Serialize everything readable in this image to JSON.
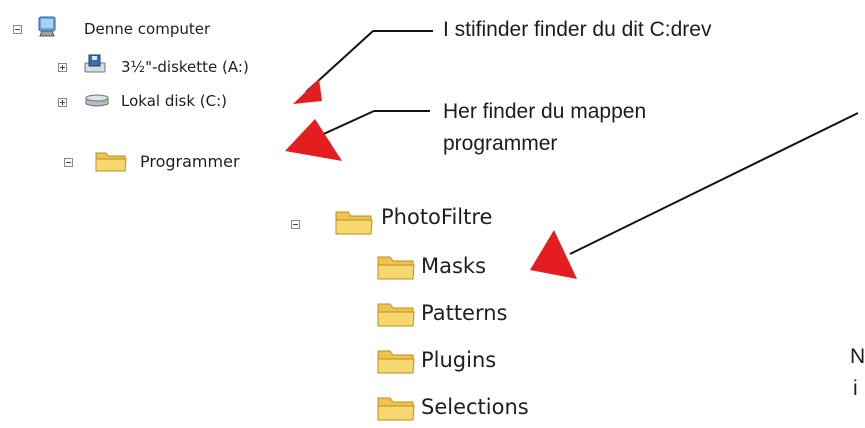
{
  "tree": {
    "computer": "Denne computer",
    "floppy": "3½\"-diskette (A:)",
    "local_disk": "Lokal disk (C:)",
    "programs": "Programmer",
    "photofiltre": "PhotoFiltre",
    "subfolders": [
      "Masks",
      "Patterns",
      "Plugins",
      "Selections"
    ]
  },
  "annotations": {
    "c_drive": "I stifinder finder du dit C:drev",
    "programs_line1": "Her finder du mappen",
    "programs_line2": "programmer",
    "bottom_right_line1": "N",
    "bottom_right_line2": "i"
  },
  "icons": {
    "computer": "computer-icon",
    "floppy": "floppy-drive-icon",
    "disk": "hard-disk-icon",
    "folder": "folder-icon"
  },
  "colors": {
    "arrow": "#e41e20",
    "callout_line": "#111111",
    "folder_fill": "#f7d770",
    "folder_edge": "#b88f1f"
  }
}
